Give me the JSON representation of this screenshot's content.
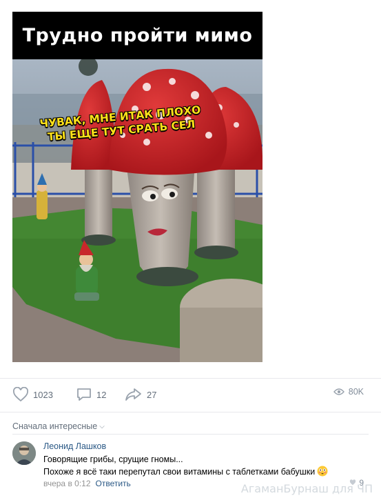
{
  "post": {
    "caption": "Трудно пройти мимо",
    "meme_text": "ЧУВАК, МНЕ ИТАК ПЛОХО ТЫ ЕЩЕ ТУТ СРАТЬ СЕЛ"
  },
  "actions": {
    "likes": "1023",
    "comments": "12",
    "shares": "27",
    "views": "80K",
    "icons": [
      "heart-icon",
      "comment-icon",
      "share-icon",
      "eye-icon"
    ]
  },
  "comments_section": {
    "sort_label": "Сначала интересные",
    "items": [
      {
        "author": "Леонид Лашков",
        "line1": "Говорящие грибы, срущие гномы...",
        "line2": "Похоже я всё таки перепутал свои витамины с таблетками бабушки",
        "time": "вчера в 0:12",
        "reply_label": "Ответить",
        "likes": "9"
      }
    ]
  },
  "watermark": "АгаманБурнаш для ЧП",
  "colors": {
    "link": "#2a5885",
    "muted": "#626d7a",
    "divider": "#e7e8ec",
    "meme_text": "#ffe11a"
  }
}
